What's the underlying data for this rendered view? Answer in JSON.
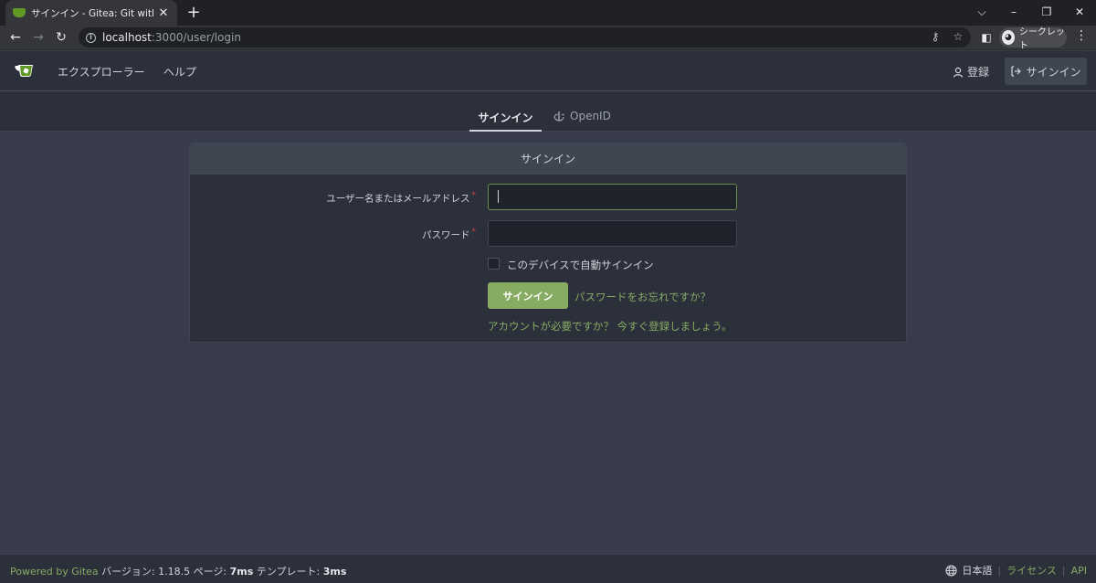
{
  "browser": {
    "tab_title": "サインイン - Gitea: Git with a cup of tea",
    "tab_close": "✕",
    "new_tab": "+",
    "url_host": "localhost",
    "url_path": ":3000/user/login",
    "profile_label": "シークレット"
  },
  "header": {
    "nav": [
      "エクスプローラー",
      "ヘルプ"
    ],
    "register_label": "登録",
    "signin_label": "サインイン"
  },
  "tabs": {
    "signin": "サインイン",
    "openid": "OpenID"
  },
  "form": {
    "title": "サインイン",
    "username_label": "ユーザー名またはメールアドレス",
    "username_value": "",
    "password_label": "パスワード",
    "password_value": "",
    "remember_label": "このデバイスで自動サインイン",
    "submit_label": "サインイン",
    "forgot_label": "パスワードをお忘れですか？",
    "need_account_label": "アカウントが必要ですか？ 今すぐ登録しましょう。",
    "required_mark": "*"
  },
  "footer": {
    "powered_by": "Powered by Gitea",
    "version_label": "バージョン:",
    "version": "1.18.5",
    "page_label": "ページ:",
    "page_time": "7ms",
    "template_label": "テンプレート:",
    "template_time": "3ms",
    "language": "日本語",
    "license": "ライセンス",
    "api": "API"
  },
  "colors": {
    "accent": "#87ab63",
    "header_bg": "#2b303b",
    "body_bg": "#383c4a",
    "required": "#cc4848"
  }
}
